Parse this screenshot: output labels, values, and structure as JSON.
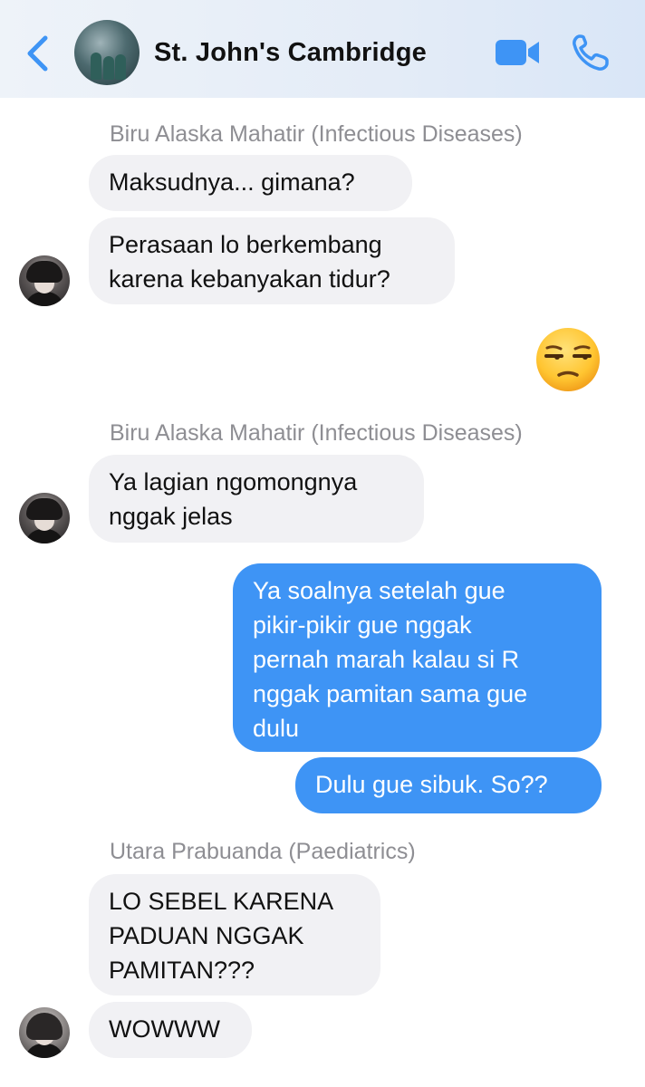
{
  "header": {
    "title": "St. John's Cambridge",
    "icons": [
      "back-icon",
      "video-call-icon",
      "phone-call-icon"
    ],
    "accent_color": "#3e94f5"
  },
  "messages": [
    {
      "sender": "Biru Alaska Mahatir (Infectious Diseases)"
    },
    {
      "text_1": "Maksudnya... gimana?"
    },
    {
      "text_2_line1": "Perasaan lo berkembang",
      "text_2_line2": "karena kebanyakan tidur?"
    },
    {
      "emoji": "unamused-face-emoji"
    },
    {
      "sender": "Biru Alaska Mahatir (Infectious Diseases)"
    },
    {
      "text_3_line1": "Ya lagian ngomongnya",
      "text_3_line2": "nggak jelas"
    },
    {
      "out_1_lines": [
        "Ya soalnya setelah gue",
        "pikir-pikir gue nggak",
        "pernah marah kalau si R",
        "nggak pamitan sama gue",
        "dulu"
      ]
    },
    {
      "out_2": "Dulu gue sibuk. So??"
    },
    {
      "sender": "Utara Prabuanda (Paediatrics)"
    },
    {
      "text_4_lines": [
        "LO SEBEL KARENA",
        "PADUAN NGGAK",
        "PAMITAN???"
      ]
    },
    {
      "text_5": "WOWWW"
    }
  ]
}
